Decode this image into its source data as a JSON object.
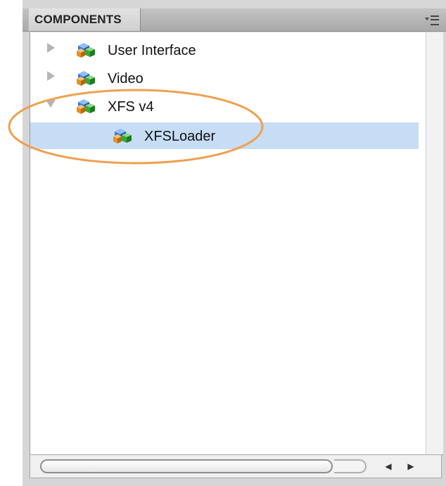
{
  "panel": {
    "tab_label": "COMPONENTS",
    "menu_icon": "panel-menu-icon"
  },
  "tree": {
    "items": [
      {
        "label": "User Interface",
        "expanded": false,
        "level": 0,
        "selected": false,
        "icon": "component-cube-icon"
      },
      {
        "label": "Video",
        "expanded": false,
        "level": 0,
        "selected": false,
        "icon": "component-cube-icon"
      },
      {
        "label": "XFS v4",
        "expanded": true,
        "level": 0,
        "selected": false,
        "icon": "component-cube-icon"
      },
      {
        "label": "XFSLoader",
        "level": 1,
        "selected": true,
        "icon": "component-cube-icon"
      }
    ]
  },
  "scrollbar": {
    "left_arrow": "◀",
    "right_arrow": "▶"
  },
  "colors": {
    "selection": "#c7ddf5",
    "annotation_ring": "#f0a050",
    "cube_blue": "#3b78d8",
    "cube_green": "#3aa83a",
    "cube_orange": "#e8901e"
  }
}
